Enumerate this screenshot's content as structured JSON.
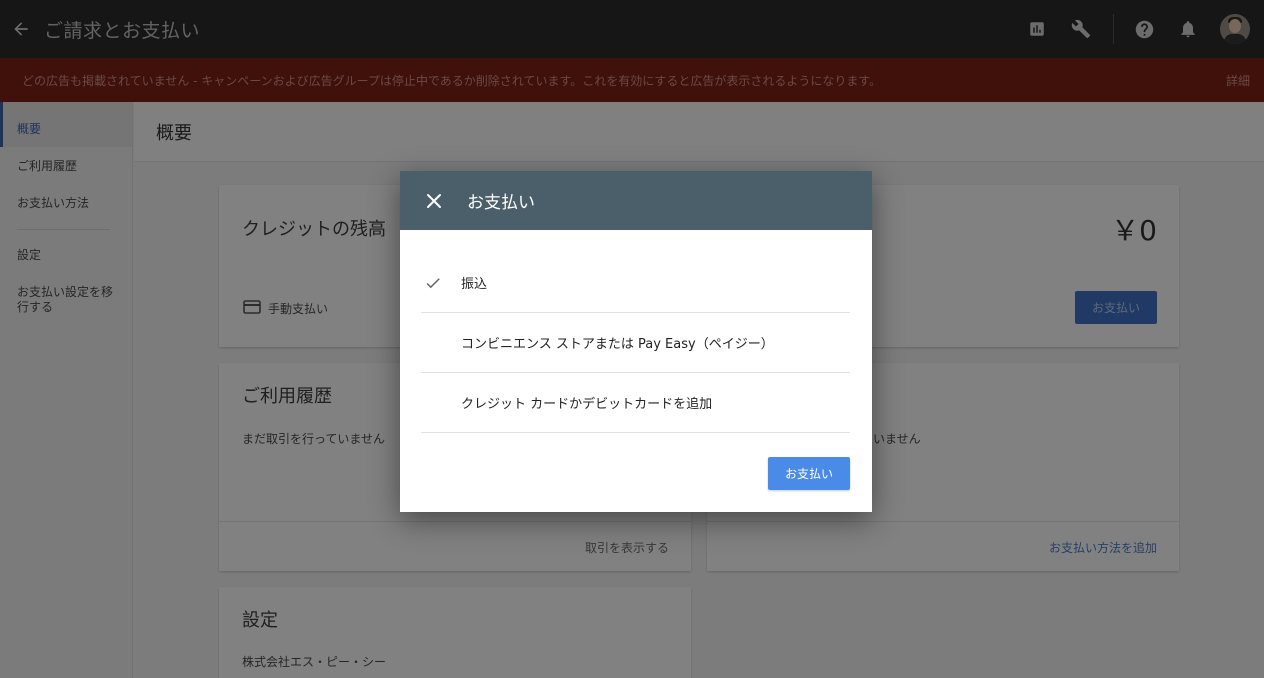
{
  "topbar": {
    "title": "ご請求とお支払い",
    "icons": [
      "back-arrow-icon",
      "bar-chart-icon",
      "wrench-icon",
      "help-icon",
      "notification-bell-icon"
    ]
  },
  "alert": {
    "message": "どの広告も掲載されていません - キャンペーンおよび広告グループは停止中であるか削除されています。これを有効にすると広告が表示されるようになります。",
    "details_label": "詳細"
  },
  "sidebar": {
    "items": [
      {
        "label": "概要",
        "active": true
      },
      {
        "label": "ご利用履歴"
      },
      {
        "label": "お支払い方法"
      },
      {
        "label": "設定"
      },
      {
        "label": "お支払い設定を移行する"
      }
    ]
  },
  "page": {
    "title": "概要"
  },
  "credit_card": {
    "title": "クレジットの残高",
    "balance": "￥0",
    "payment_type": "手動支払い",
    "pay_button": "お支払い"
  },
  "history_card": {
    "title": "ご利用履歴",
    "empty_text": "まだ取引を行っていません",
    "footer_link": "取引を表示する"
  },
  "payment_methods_card": {
    "empty_text_partial": "いません",
    "footer_link": "お支払い方法を追加"
  },
  "settings_card": {
    "title": "設定",
    "company": "株式会社エス・ピー・シー"
  },
  "dialog": {
    "title": "お支払い",
    "options": [
      {
        "label": "振込",
        "selected": true
      },
      {
        "label": "コンビニエンス ストアまたは Pay Easy（ペイジー）",
        "selected": false
      },
      {
        "label": "クレジット カードかデビットカードを追加",
        "selected": false
      }
    ],
    "submit_label": "お支払い"
  },
  "colors": {
    "topbar": "#2b2b2b",
    "alert": "#7b1f15",
    "dialog_header": "#4b5f6a",
    "primary_button": "#4a8be8",
    "link": "#4a7cc4"
  }
}
